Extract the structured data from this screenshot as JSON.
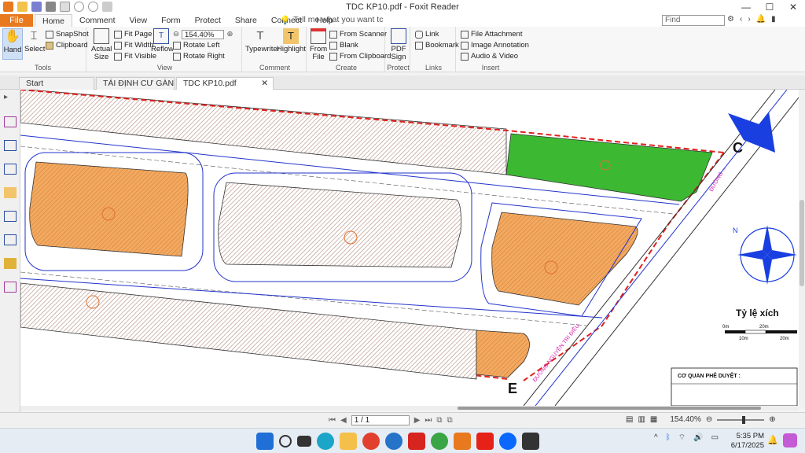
{
  "window": {
    "title": "TDC KP10.pdf - Foxit Reader"
  },
  "menu": {
    "file": "File",
    "tabs": [
      "Home",
      "Comment",
      "View",
      "Form",
      "Protect",
      "Share",
      "Connect",
      "Help"
    ],
    "tell_me": "Tell me what you want tc",
    "find_placeholder": "Find"
  },
  "ribbon": {
    "tools": {
      "hand": "Hand",
      "select": "Select",
      "snapshot": "SnapShot",
      "clipboard": "Clipboard",
      "label": "Tools"
    },
    "view": {
      "actual_size": "Actual Size",
      "fit_page": "Fit Page",
      "fit_width": "Fit Width",
      "fit_visible": "Fit Visible",
      "reflow": "Reflow",
      "zoom": "154.40%",
      "rotate_left": "Rotate Left",
      "rotate_right": "Rotate Right",
      "label": "View"
    },
    "comment": {
      "typewriter": "Typewriter",
      "highlight": "Highlight",
      "label": "Comment"
    },
    "create": {
      "from_file": "From File",
      "from_scanner": "From Scanner",
      "blank": "Blank",
      "from_clipboard": "From Clipboard",
      "label": "Create"
    },
    "protect": {
      "pdf_sign": "PDF Sign",
      "label": "Protect"
    },
    "links": {
      "link": "Link",
      "bookmark": "Bookmark",
      "label": "Links"
    },
    "insert": {
      "file_attachment": "File Attachment",
      "image_annotation": "Image Annotation",
      "audio_video": "Audio & Video",
      "label": "Insert"
    }
  },
  "doc_tabs": [
    "Start",
    "TÁI ĐỊNH CƯ GÀNH D...",
    "TDC KP10.pdf"
  ],
  "map": {
    "point_c": "C",
    "point_e": "E",
    "scale_title": "Tỷ lệ xích",
    "scale_ticks": [
      "0m",
      "20m",
      "10m",
      "20m"
    ],
    "approval_box": "CƠ QUAN PHÊ DUYỆT :",
    "compass_n": "N",
    "street_name": "ĐƯỜNG NGUYỄN TRI ĐIỀU",
    "street_name2": "ĐƯỜNG ..."
  },
  "status": {
    "page": "1 / 1",
    "zoom": "154.40%"
  },
  "taskbar": {
    "time": "5:35 PM",
    "date": "6/17/2025"
  },
  "colors": {
    "accent": "#e8791f",
    "lot_orange": "#f4a960",
    "park_green": "#3cb832",
    "boundary_red": "#e0201c",
    "road_blue": "#2233cc"
  }
}
